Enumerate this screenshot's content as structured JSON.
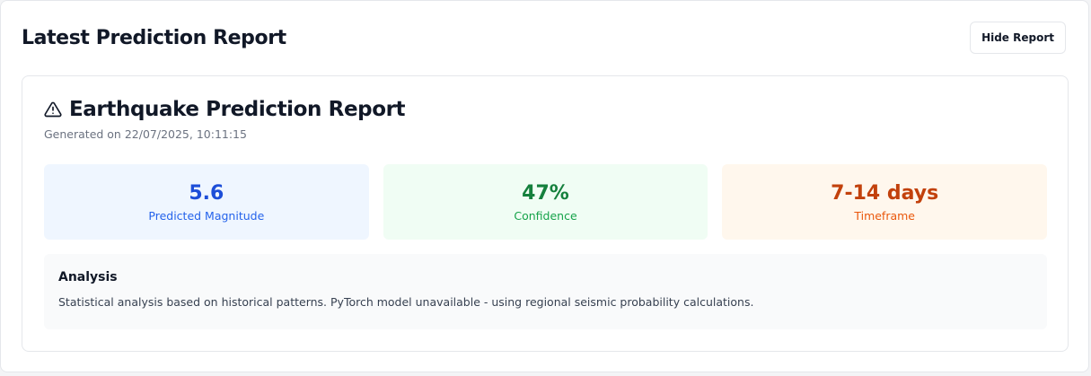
{
  "header": {
    "title": "Latest Prediction Report",
    "hide_button": "Hide Report"
  },
  "report": {
    "icon": "warning-triangle-icon",
    "title": "Earthquake Prediction Report",
    "generated": "Generated on 22/07/2025, 10:11:15",
    "stats": [
      {
        "value": "5.6",
        "label": "Predicted Magnitude",
        "color": "#1d4ed8"
      },
      {
        "value": "47%",
        "label": "Confidence",
        "color": "#15803d"
      },
      {
        "value": "7-14 days",
        "label": "Timeframe",
        "color": "#c2410c"
      }
    ],
    "analysis": {
      "title": "Analysis",
      "text": "Statistical analysis based on historical patterns. PyTorch model unavailable - using regional seismic probability calculations."
    }
  }
}
